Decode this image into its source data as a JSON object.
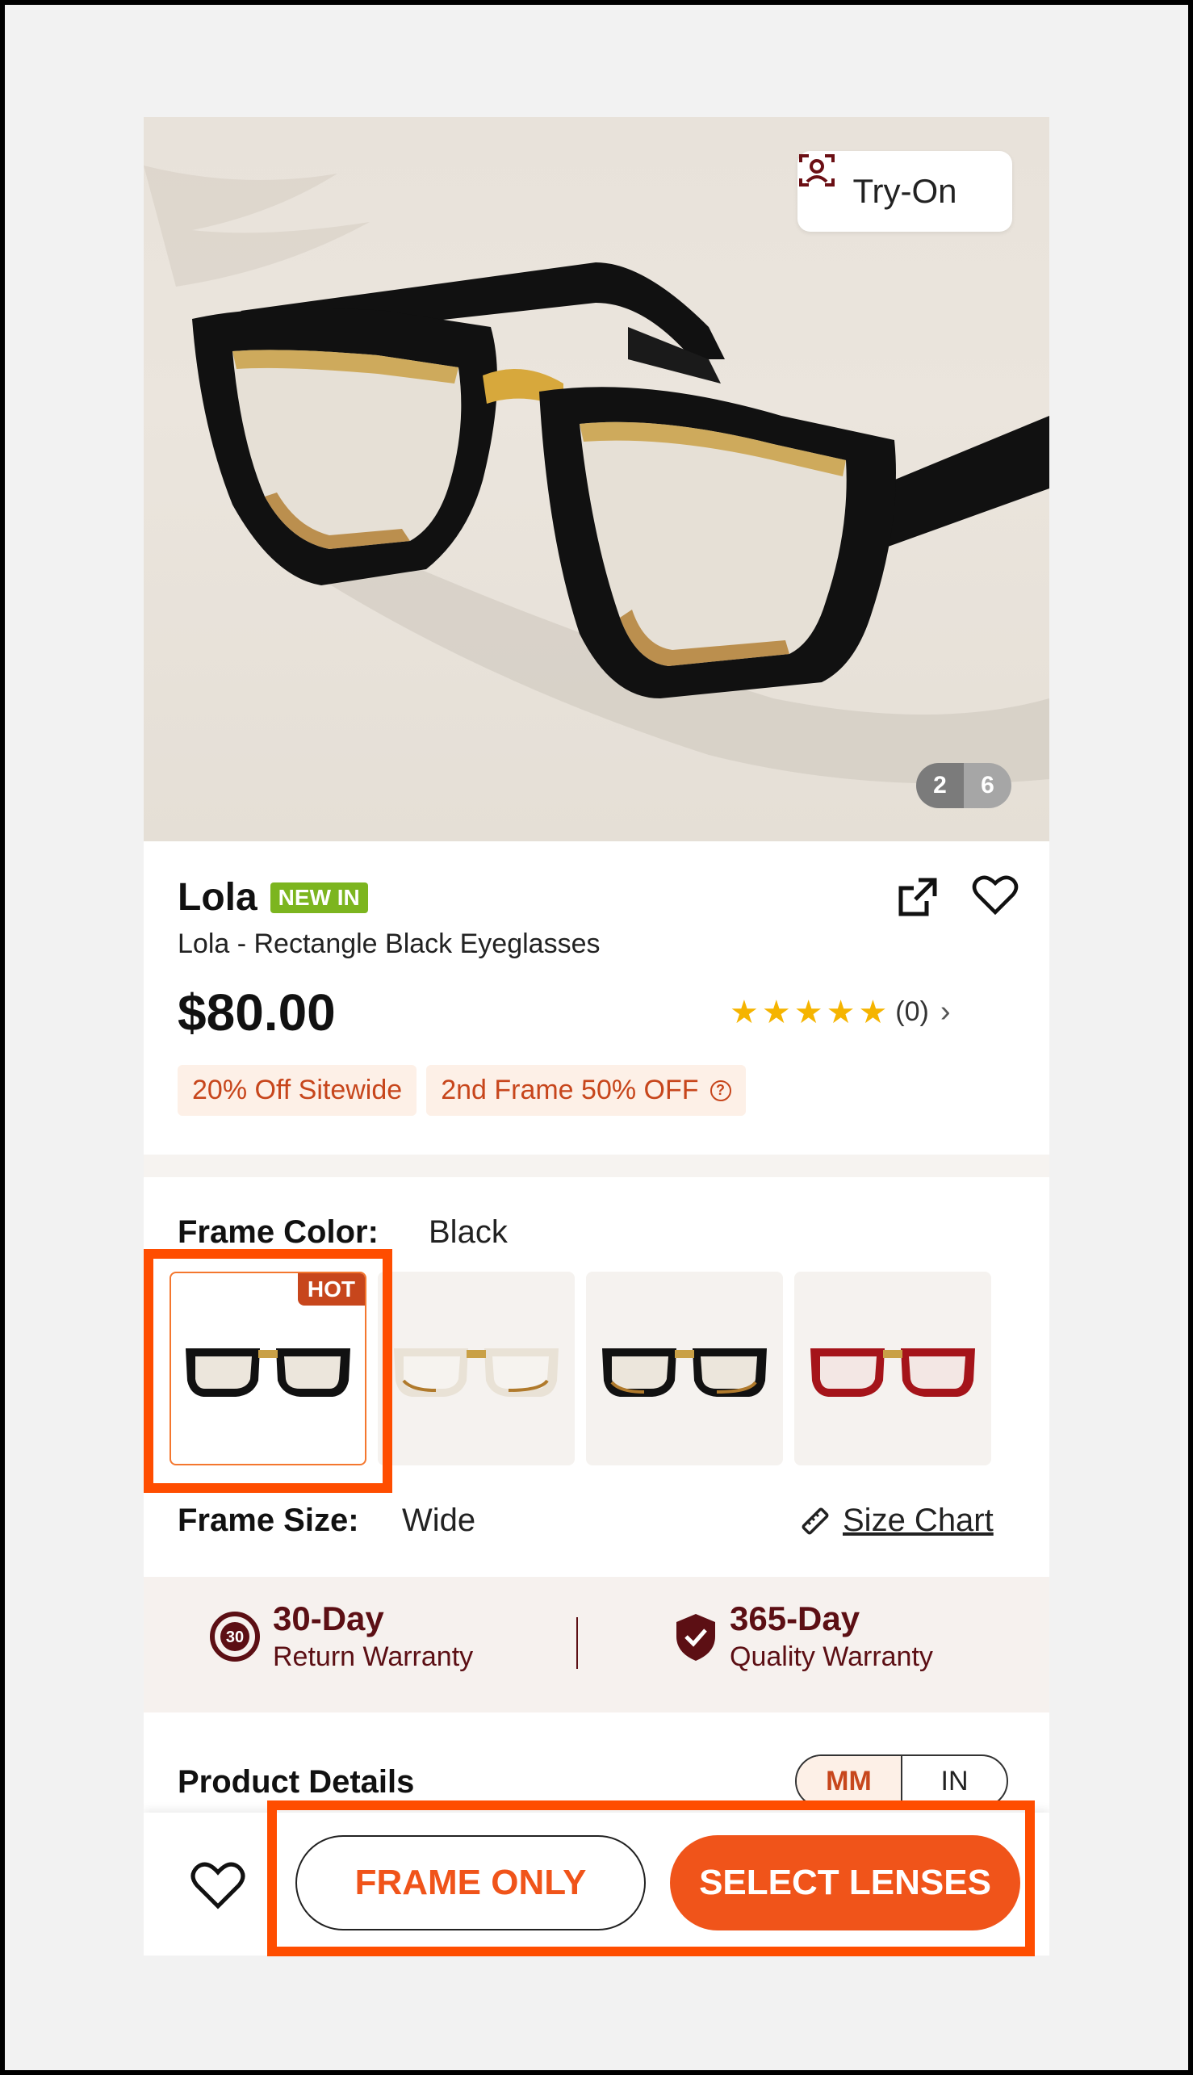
{
  "hero": {
    "tryon_label": "Try-On",
    "image_current": "2",
    "image_total": "6"
  },
  "product": {
    "name": "Lola",
    "badge": "NEW IN",
    "subtitle": "Lola - Rectangle Black Eyeglasses",
    "price": "$80.00",
    "rating_count": "(0)",
    "stars": 5,
    "promos": [
      "20% Off Sitewide",
      "2nd Frame 50% OFF"
    ]
  },
  "frame_color": {
    "label": "Frame Color:",
    "value": "Black",
    "hot_label": "HOT",
    "swatches": [
      {
        "color": "black-tortoise",
        "selected": true
      },
      {
        "color": "clear-tortoise",
        "selected": false
      },
      {
        "color": "black-tortoise-2",
        "selected": false
      },
      {
        "color": "red",
        "selected": false
      }
    ]
  },
  "frame_size": {
    "label": "Frame Size:",
    "value": "Wide",
    "size_chart_label": "Size Chart"
  },
  "warranty": {
    "return_days": "30-Day",
    "return_label": "Return Warranty",
    "return_icon_text": "30",
    "quality_days": "365-Day",
    "quality_label": "Quality Warranty"
  },
  "details": {
    "label": "Product Details",
    "unit_mm": "MM",
    "unit_in": "IN"
  },
  "bottom_bar": {
    "frame_only": "FRAME ONLY",
    "select_lenses": "SELECT LENSES"
  },
  "colors": {
    "accent": "#f0541a",
    "highlight": "#ff4d00",
    "warranty_text": "#5c0f14",
    "star": "#f5b400",
    "new_badge": "#7cb51f"
  }
}
